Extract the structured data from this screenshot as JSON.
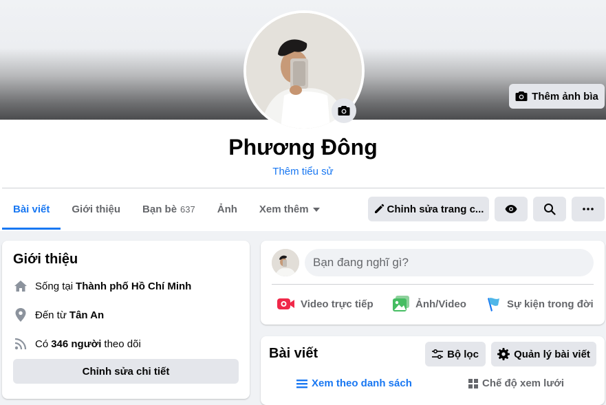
{
  "cover": {
    "add_cover_label": "Thêm ảnh bìa"
  },
  "profile": {
    "name": "Phương Đông",
    "bio_link": "Thêm tiểu sử"
  },
  "tabs": [
    {
      "label": "Bài viết",
      "active": true
    },
    {
      "label": "Giới thiệu"
    },
    {
      "label": "Bạn bè",
      "count": "637"
    },
    {
      "label": "Ảnh"
    },
    {
      "label": "Xem thêm"
    }
  ],
  "actions": {
    "edit_profile": "Chỉnh sửa trang c..."
  },
  "intro": {
    "title": "Giới thiệu",
    "lives_prefix": "Sống tại",
    "lives_place": "Thành phố Hồ Chí Minh",
    "from_prefix": "Đến từ",
    "from_place": "Tân An",
    "followers_prefix": "Có",
    "followers_count": "346 người",
    "followers_suffix": "theo dõi",
    "edit_details": "Chỉnh sửa chi tiết"
  },
  "composer": {
    "placeholder": "Bạn đang nghĩ gì?",
    "live_video": "Video trực tiếp",
    "photo_video": "Ảnh/Video",
    "life_event": "Sự kiện trong đời"
  },
  "posts": {
    "title": "Bài viết",
    "filter_label": "Bộ lọc",
    "manage_label": "Quản lý bài viết",
    "list_view": "Xem theo danh sách",
    "grid_view": "Chế độ xem lưới"
  },
  "colors": {
    "accent": "#1877f2",
    "live_red": "#f02849",
    "photo_green": "#45bd62",
    "event_blue": "#1877f2"
  }
}
